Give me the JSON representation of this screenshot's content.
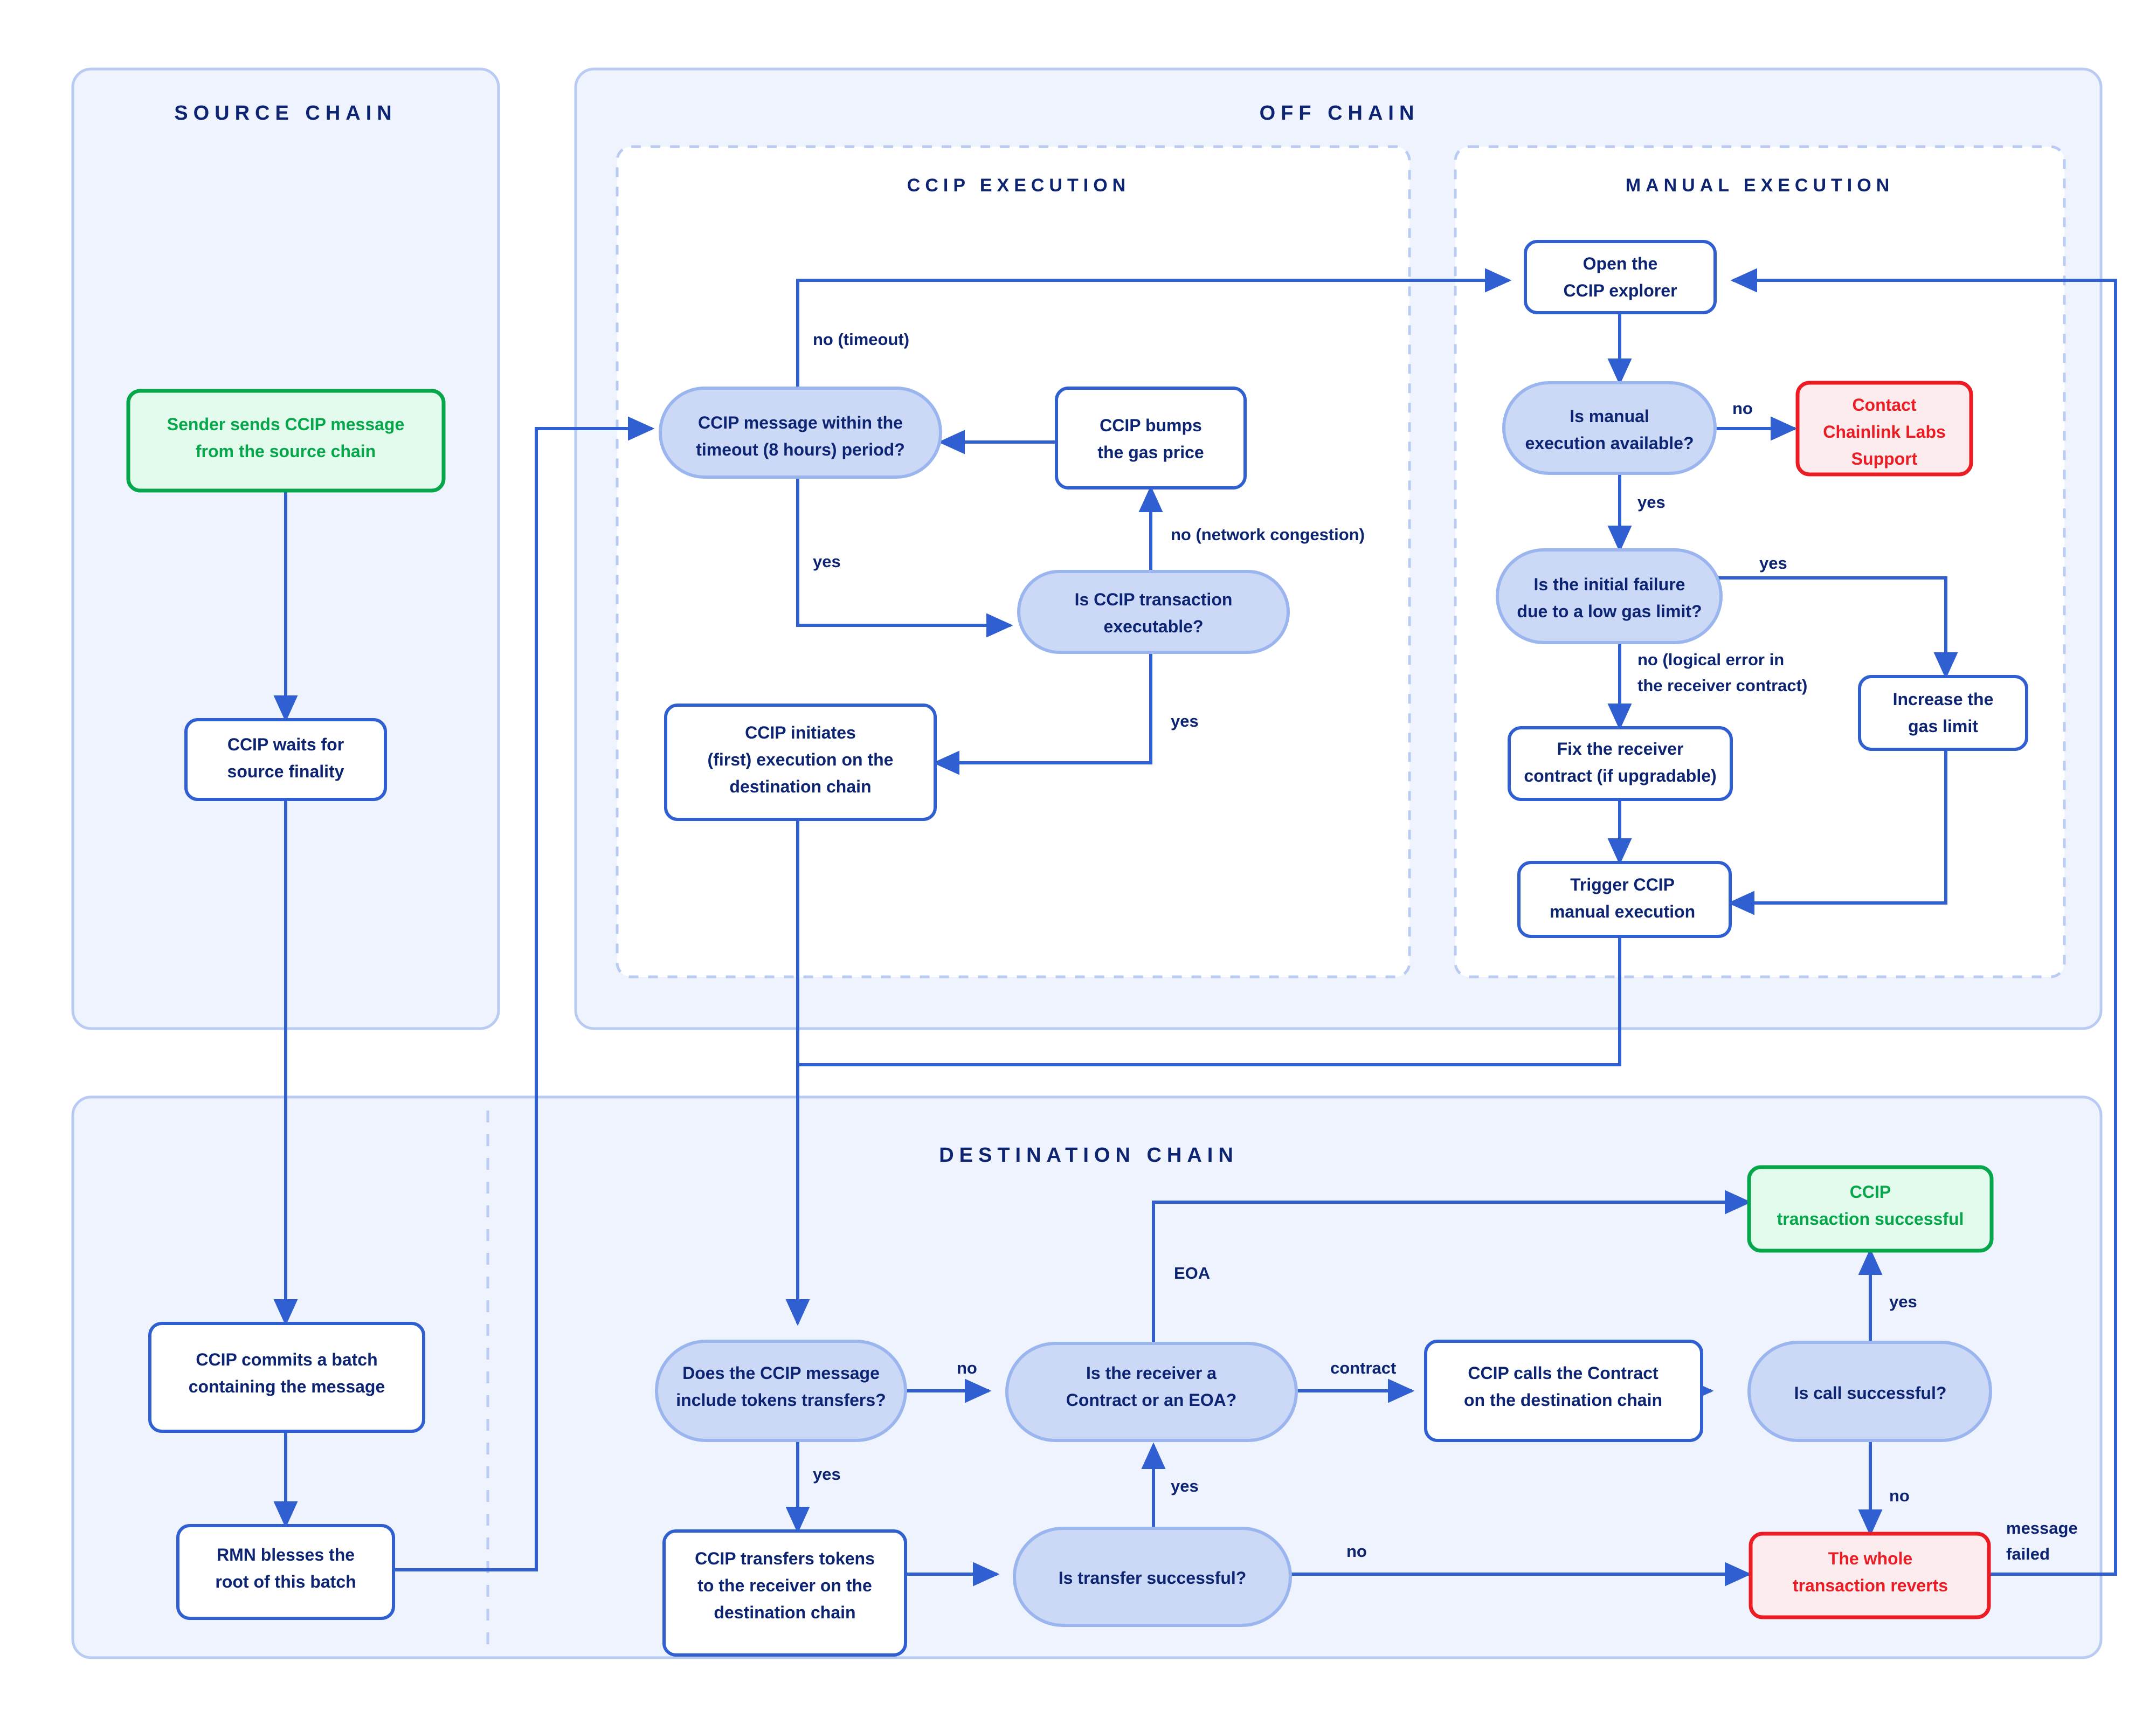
{
  "diagram": {
    "title_hidden": "CCIP Execution Lifecycle Flowchart",
    "colors": {
      "panel_fill": "#eef3fd",
      "panel_stroke": "#b9cbf2",
      "dashed_stroke": "#b9cbf2",
      "edge": "#2f5fd0",
      "node_stroke": "#2f5fd0",
      "node_fill": "#ffffff",
      "decision_fill": "#ccd9f6",
      "decision_stroke": "#9bb6ee",
      "text_navy": "#0d2472",
      "green": "#06a64b",
      "green_fill": "#e2fbec",
      "red": "#ec1c24",
      "red_fill": "#fdeced"
    },
    "panels": [
      {
        "id": "source-chain",
        "label": "SOURCE CHAIN"
      },
      {
        "id": "off-chain",
        "label": "OFF CHAIN"
      },
      {
        "id": "destination-chain",
        "label": "DESTINATION CHAIN"
      }
    ],
    "subpanels": [
      {
        "id": "ccip-execution",
        "label": "CCIP EXECUTION"
      },
      {
        "id": "manual-execution",
        "label": "MANUAL EXECUTION"
      }
    ],
    "nodes": {
      "sender_sends": {
        "lines": [
          "Sender sends CCIP message",
          "from the source chain"
        ],
        "shape": "process",
        "style": "green"
      },
      "waits_finality": {
        "lines": [
          "CCIP waits for",
          "source finality"
        ],
        "shape": "process",
        "style": "plain"
      },
      "commits_batch": {
        "lines": [
          "CCIP commits a batch",
          "containing the message"
        ],
        "shape": "process",
        "style": "plain"
      },
      "rmn_blesses": {
        "lines": [
          "RMN blesses the",
          "root of this batch"
        ],
        "shape": "process",
        "style": "plain"
      },
      "within_timeout": {
        "lines": [
          "CCIP message within the",
          "timeout (8 hours) period?"
        ],
        "shape": "decision",
        "style": "decision"
      },
      "bumps_gas": {
        "lines": [
          "CCIP bumps",
          "the gas price"
        ],
        "shape": "process",
        "style": "plain"
      },
      "tx_executable": {
        "lines": [
          "Is CCIP transaction",
          "executable?"
        ],
        "shape": "decision",
        "style": "decision"
      },
      "initiates_first": {
        "lines": [
          "CCIP initiates",
          "(first) execution on the",
          "destination chain"
        ],
        "shape": "process",
        "style": "plain"
      },
      "open_explorer": {
        "lines": [
          "Open the",
          "CCIP explorer"
        ],
        "shape": "process",
        "style": "plain"
      },
      "manual_available": {
        "lines": [
          "Is manual",
          "execution available?"
        ],
        "shape": "decision",
        "style": "decision"
      },
      "contact_support": {
        "lines": [
          "Contact",
          "Chainlink Labs",
          "Support"
        ],
        "shape": "process",
        "style": "red"
      },
      "initial_failure": {
        "lines": [
          "Is the initial failure",
          "due to a low gas limit?"
        ],
        "shape": "decision",
        "style": "decision"
      },
      "increase_gas": {
        "lines": [
          "Increase the",
          "gas limit"
        ],
        "shape": "process",
        "style": "plain"
      },
      "fix_receiver": {
        "lines": [
          "Fix the receiver",
          "contract (if upgradable)"
        ],
        "shape": "process",
        "style": "plain"
      },
      "trigger_manual": {
        "lines": [
          "Trigger CCIP",
          "manual execution"
        ],
        "shape": "process",
        "style": "plain"
      },
      "include_tokens": {
        "lines": [
          "Does the CCIP message",
          "include tokens transfers?"
        ],
        "shape": "decision",
        "style": "decision"
      },
      "transfers_tokens": {
        "lines": [
          "CCIP transfers tokens",
          "to the receiver on the",
          "destination chain"
        ],
        "shape": "process",
        "style": "plain"
      },
      "transfer_successful": {
        "lines": [
          "Is transfer successful?"
        ],
        "shape": "decision",
        "style": "decision"
      },
      "receiver_type": {
        "lines": [
          "Is the receiver a",
          "Contract or an EOA?"
        ],
        "shape": "decision",
        "style": "decision"
      },
      "calls_contract": {
        "lines": [
          "CCIP calls the Contract",
          "on the destination chain"
        ],
        "shape": "process",
        "style": "plain"
      },
      "call_successful": {
        "lines": [
          "Is call successful?"
        ],
        "shape": "decision",
        "style": "decision"
      },
      "tx_successful": {
        "lines": [
          "CCIP",
          "transaction successful"
        ],
        "shape": "process",
        "style": "green"
      },
      "whole_reverts": {
        "lines": [
          "The whole",
          "transaction reverts"
        ],
        "shape": "process",
        "style": "red"
      }
    },
    "edge_labels": {
      "no_timeout": "no (timeout)",
      "yes_timeout": "yes",
      "no_congestion": "no (network congestion)",
      "yes_executable": "yes",
      "no_manual": "no",
      "yes_manual": "yes",
      "yes_gaslimit": "yes",
      "no_logical_error_l1": "no (logical error in",
      "no_logical_error_l2": "the receiver contract)",
      "no_tokens": "no",
      "yes_tokens": "yes",
      "yes_transfer": "yes",
      "no_transfer": "no",
      "eoa": "EOA",
      "contract": "contract",
      "yes_call": "yes",
      "no_call": "no",
      "message_failed_l1": "message",
      "message_failed_l2": "failed"
    }
  }
}
